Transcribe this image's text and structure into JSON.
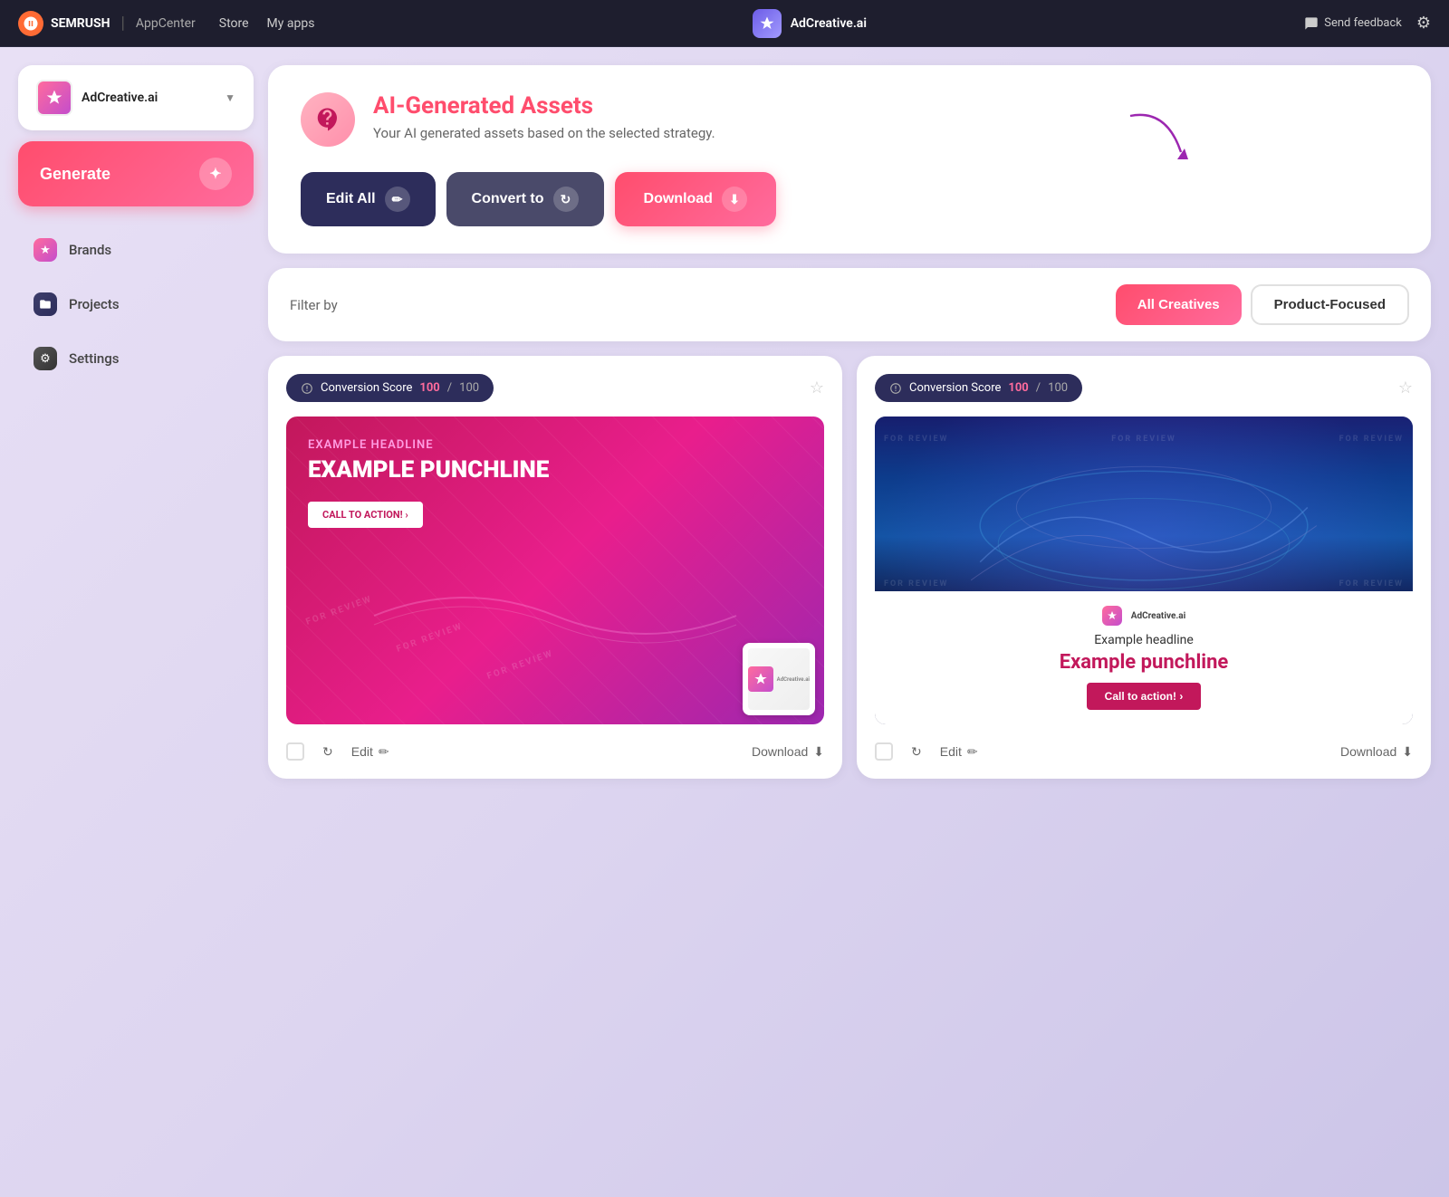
{
  "topnav": {
    "semrush": "SEMRUSH",
    "appcenter": "AppCenter",
    "store": "Store",
    "myapps": "My apps",
    "app_name": "AdCreative.ai",
    "feedback": "Send feedback"
  },
  "sidebar": {
    "brand_name": "AdCreative.ai",
    "generate_label": "Generate",
    "nav_items": [
      {
        "label": "Brands",
        "icon": "star"
      },
      {
        "label": "Projects",
        "icon": "folder"
      },
      {
        "label": "Settings",
        "icon": "gear"
      }
    ]
  },
  "header": {
    "title": "AI-Generated Assets",
    "subtitle": "Your AI generated assets based on the selected strategy.",
    "edit_all": "Edit All",
    "convert_to": "Convert to",
    "download": "Download"
  },
  "filter": {
    "filter_by": "Filter by",
    "all_creatives": "All Creatives",
    "product_focused": "Product-Focused"
  },
  "cards": [
    {
      "conversion_score_label": "Conversion Score",
      "score": "100",
      "max_score": "100",
      "headline": "EXAMPLE HEADLINE",
      "punchline": "EXAMPLE PUNCHLINE",
      "cta": "CALL TO ACTION! ›",
      "edit_label": "Edit",
      "download_label": "Download"
    },
    {
      "conversion_score_label": "Conversion Score",
      "score": "100",
      "max_score": "100",
      "headline": "Example headline",
      "punchline": "Example punchline",
      "cta": "Call to action! ›",
      "edit_label": "Edit",
      "download_label": "Download"
    }
  ]
}
